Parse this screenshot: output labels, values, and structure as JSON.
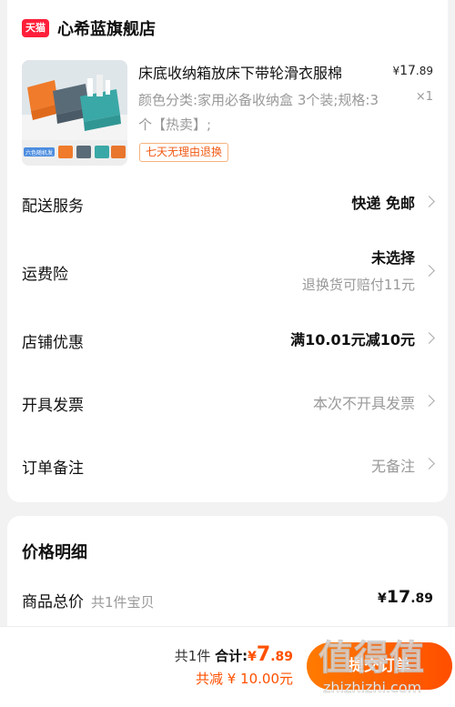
{
  "shop": {
    "badge": "天猫",
    "name": "心希蓝旗舰店"
  },
  "product": {
    "image_icon": "storage-baskets-image",
    "image_tag": "六色随机发",
    "title": "床底收纳箱放床下带轮滑衣服棉",
    "price_currency": "¥",
    "price_int": "17",
    "price_dec": ".89",
    "sku_text": "颜色分类:家用必备收纳盒 3个装;规格:3个【热卖】;",
    "quantity": "×1",
    "return_tag": "七天无理由退换"
  },
  "options": [
    {
      "label": "配送服务",
      "value": "快递 免邮",
      "sub": ""
    },
    {
      "label": "运费险",
      "value": "未选择",
      "sub": "退换货可赔付11元"
    },
    {
      "label": "店铺优惠",
      "value": "满10.01元减10元",
      "sub": ""
    },
    {
      "label": "开具发票",
      "value": "本次不开具发票",
      "sub": ""
    },
    {
      "label": "订单备注",
      "value": "无备注",
      "sub": ""
    }
  ],
  "price_detail": {
    "title": "价格明细",
    "row_label": "商品总价",
    "row_sub": "共1件宝贝",
    "currency": "¥",
    "int": "17",
    "dec": ".89"
  },
  "bottom": {
    "count": "共1件",
    "total_label": "合计:",
    "currency": "¥",
    "total_int": "7",
    "total_dec": ".89",
    "discount": "共减 ¥ 10.00元",
    "submit": "提交订单"
  },
  "watermark": {
    "main": "值得值",
    "url": "zhizhizhi.com"
  },
  "colors": {
    "accent": "#ff5000",
    "tmall": "#ff1f3a",
    "muted": "#999999"
  }
}
